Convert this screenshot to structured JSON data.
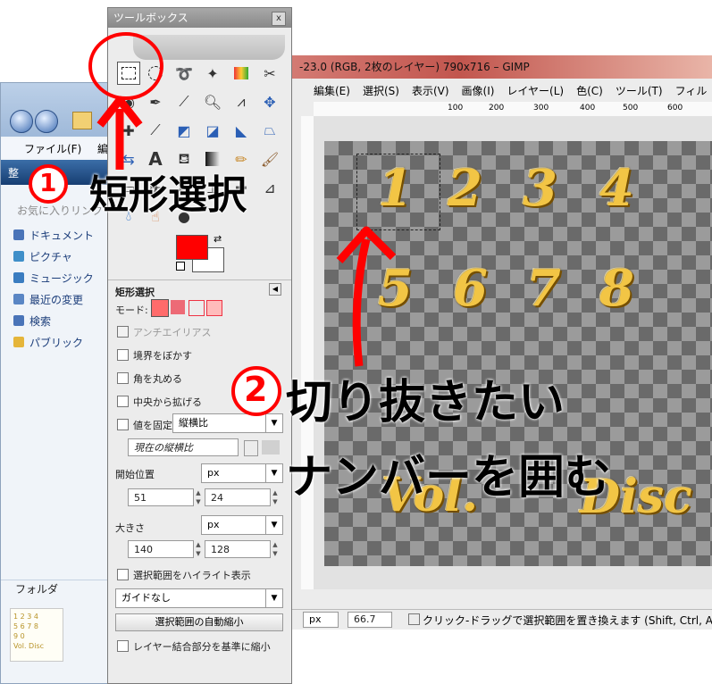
{
  "explorer": {
    "menu_file": "ファイル(F)",
    "menu_edit": "編",
    "organize": "整",
    "favorites_title": "お気に入りリンク",
    "favorites": [
      {
        "label": "ドキュメント",
        "color": "#4a74b8"
      },
      {
        "label": "ピクチャ",
        "color": "#3f8fc9"
      },
      {
        "label": "ミュージック",
        "color": "#3a7cc0"
      },
      {
        "label": "最近の変更",
        "color": "#5a86c4"
      },
      {
        "label": "検索",
        "color": "#4a74b8"
      },
      {
        "label": "パブリック",
        "color": "#e5b53a"
      }
    ],
    "folder_label": "フォルダ",
    "thumb_text": [
      "1 2 3 4",
      "5 6 7 8",
      "9 0",
      "Vol. Disc"
    ]
  },
  "gimp": {
    "title": "-23.0 (RGB, 2枚のレイヤー) 790x716 – GIMP",
    "menu": [
      "編集(E)",
      "選択(S)",
      "表示(V)",
      "画像(I)",
      "レイヤー(L)",
      "色(C)",
      "ツール(T)",
      "フィル"
    ],
    "ruler_ticks": [
      "100",
      "200",
      "300",
      "400",
      "500",
      "600"
    ],
    "canvas_digits": [
      "1",
      "2",
      "3",
      "4",
      "5",
      "6",
      "7",
      "8"
    ],
    "canvas_words": [
      "Vol.",
      "Disc"
    ],
    "status": {
      "unit": "px",
      "zoom": "66.7",
      "hint": "クリック-ドラッグで選択範囲を置き換えます (Shift, Ctrl, A"
    }
  },
  "toolbox": {
    "title": "ツールボックス",
    "close": "x",
    "fg_color": "#ff0000",
    "bg_color": "#ffffff",
    "options_title": "矩形選択",
    "mode_label": "モード:",
    "antialias": "アンチエイリアス",
    "feather": "境界をぼかす",
    "round": "角を丸める",
    "expand_center": "中央から拡げる",
    "fixed": "値を固定",
    "fixed_value": "縦横比",
    "current_ratio": "現在の縦横比",
    "position_label": "開始位置",
    "position_unit": "px",
    "pos_x": "51",
    "pos_y": "24",
    "size_label": "大きさ",
    "size_unit": "px",
    "size_w": "140",
    "size_h": "128",
    "highlight": "選択範囲をハイライト表示",
    "guides": "ガイドなし",
    "auto_shrink": "選択範囲の自動縮小",
    "shrink_merged": "レイヤー結合部分を基準に縮小"
  },
  "annotations": {
    "step1_num": "1",
    "step1_text": "短形選択",
    "step2_num": "2",
    "step2_line1": "切り抜きたい",
    "step2_line2": "ナンバーを囲む",
    "red": "#ff0000"
  }
}
